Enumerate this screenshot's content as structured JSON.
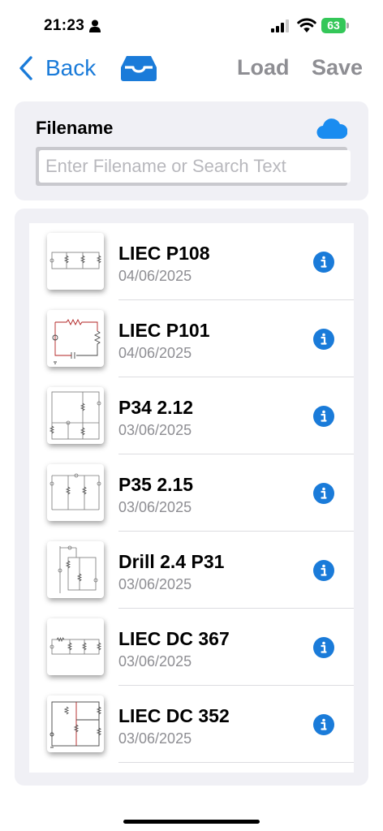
{
  "status_bar": {
    "time": "21:23",
    "battery": "63",
    "icons": [
      "person-icon",
      "signal-icon",
      "wifi-icon",
      "battery-icon"
    ]
  },
  "nav": {
    "back_label": "Back",
    "load_label": "Load",
    "save_label": "Save",
    "accent_color": "#1a7bd9",
    "disabled_color": "#8e8e93"
  },
  "filename": {
    "label": "Filename",
    "value": "",
    "placeholder": "Enter Filename or Search Text"
  },
  "files": [
    {
      "title": "LIEC P108",
      "date": "04/06/2025"
    },
    {
      "title": "LIEC P101",
      "date": "04/06/2025"
    },
    {
      "title": "P34 2.12",
      "date": "03/06/2025"
    },
    {
      "title": "P35 2.15",
      "date": "03/06/2025"
    },
    {
      "title": "Drill 2.4 P31",
      "date": "03/06/2025"
    },
    {
      "title": "LIEC DC 367",
      "date": "03/06/2025"
    },
    {
      "title": "LIEC DC 352",
      "date": "03/06/2025"
    }
  ]
}
